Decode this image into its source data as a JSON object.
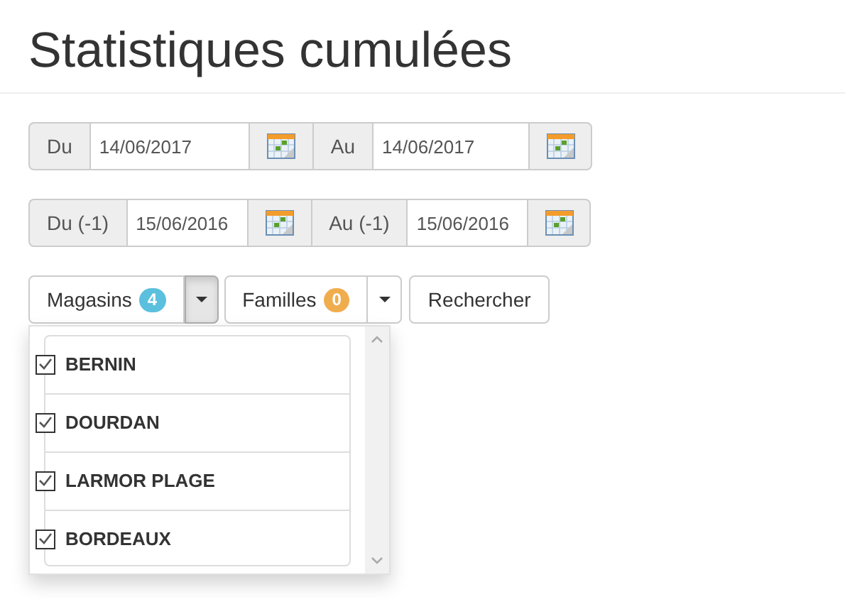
{
  "title": "Statistiques cumulées",
  "date_rows": [
    {
      "fields": [
        {
          "label": "Du",
          "value": "14/06/2017"
        },
        {
          "label": "Au",
          "value": "14/06/2017"
        }
      ]
    },
    {
      "fields": [
        {
          "label": "Du (-1)",
          "value": "15/06/2016"
        },
        {
          "label": "Au (-1)",
          "value": "15/06/2016"
        }
      ]
    }
  ],
  "filters": [
    {
      "label": "Magasins",
      "count": "4",
      "color": "#5bc0de",
      "expanded": true
    },
    {
      "label": "Familles",
      "count": "0",
      "color": "#f0ad4e",
      "expanded": false
    }
  ],
  "search_button": "Rechercher",
  "stores": [
    {
      "name": "BERNIN",
      "checked": true
    },
    {
      "name": "DOURDAN",
      "checked": true
    },
    {
      "name": "LARMOR PLAGE",
      "checked": true
    },
    {
      "name": "BORDEAUX",
      "checked": true
    }
  ]
}
